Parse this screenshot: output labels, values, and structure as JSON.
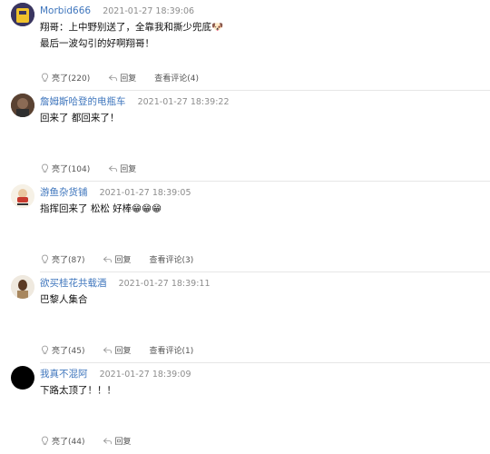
{
  "comments": [
    {
      "username": "Morbid666",
      "time": "2021-01-27 18:39:06",
      "text": "翔哥：上中野别送了，全靠我和撕少兜底🐶\n最后一波勾引的好啊翔哥！",
      "likes_label": "亮了(220)",
      "reply_label": "回复",
      "view_label": "查看评论(4)"
    },
    {
      "username": "詹姆斯哈登的电瓶车",
      "time": "2021-01-27 18:39:22",
      "text": "回来了 都回来了！",
      "likes_label": "亮了(104)",
      "reply_label": "回复",
      "view_label": ""
    },
    {
      "username": "游鱼杂货铺",
      "time": "2021-01-27 18:39:05",
      "text": "指挥回来了 松松 好棒😁😁😁",
      "likes_label": "亮了(87)",
      "reply_label": "回复",
      "view_label": "查看评论(3)"
    },
    {
      "username": "欲买桂花共载酒",
      "time": "2021-01-27 18:39:11",
      "text": "巴黎人集合",
      "likes_label": "亮了(45)",
      "reply_label": "回复",
      "view_label": "查看评论(1)"
    },
    {
      "username": "我真不混阿",
      "time": "2021-01-27 18:39:09",
      "text": "下路太顶了！！！",
      "likes_label": "亮了(44)",
      "reply_label": "回复",
      "view_label": ""
    }
  ],
  "colors": {
    "username": "#3f76bd",
    "time": "#8d8d8d",
    "action": "#555555",
    "divider": "#e6e6e6"
  }
}
